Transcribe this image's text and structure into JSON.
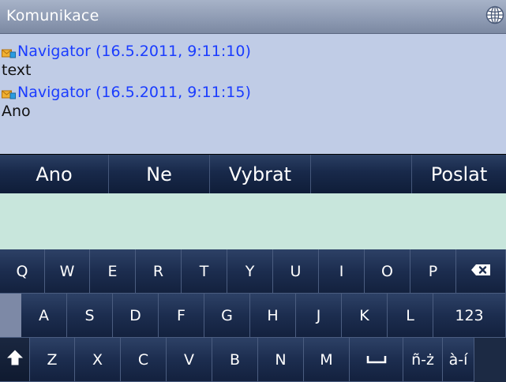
{
  "titlebar": {
    "title": "Komunikace",
    "icon": "globe-icon"
  },
  "messages": [
    {
      "sender": "Navigator (16.5.2011, 9:11:10)",
      "text": "text",
      "icon": "message-icon"
    },
    {
      "sender": "Navigator (16.5.2011, 9:11:15)",
      "text": "Ano",
      "icon": "message-icon"
    }
  ],
  "softkeys": {
    "yes": "Ano",
    "no": "Ne",
    "select": "Vybrat",
    "empty": "",
    "send": "Poslat"
  },
  "input": {
    "value": ""
  },
  "keyboard": {
    "row1": [
      "Q",
      "W",
      "E",
      "R",
      "T",
      "Y",
      "U",
      "I",
      "O",
      "P"
    ],
    "row2": [
      "A",
      "S",
      "D",
      "F",
      "G",
      "H",
      "J",
      "K",
      "L"
    ],
    "row3": [
      "Z",
      "X",
      "C",
      "V",
      "B",
      "N",
      "M"
    ],
    "numbers_label": "123",
    "accent1_label": "ñ-ż",
    "accent2_label": "à-í",
    "backspace_icon": "backspace-icon",
    "shift_icon": "shift-icon",
    "space_icon": "space-icon"
  },
  "colors": {
    "titlebar": "#8f9cb4",
    "messages_bg": "#c0cce6",
    "sender_text": "#1a3cff",
    "input_bg": "#c8e6dc",
    "key_bg": "#1c2d4f"
  }
}
